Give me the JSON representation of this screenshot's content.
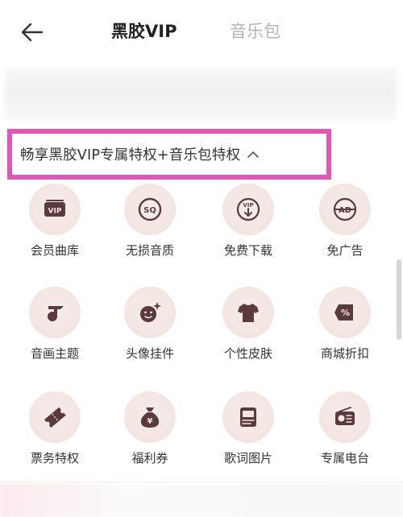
{
  "header": {
    "tabs": [
      {
        "label": "黑胶VIP",
        "active": true
      },
      {
        "label": "音乐包",
        "active": false
      }
    ]
  },
  "privileges": {
    "title": "畅享黑胶VIP专属特权+音乐包特权",
    "highlight_color": "#e256b4",
    "items": [
      {
        "label": "会员曲库",
        "icon": "vip-badge-icon"
      },
      {
        "label": "无损音质",
        "icon": "sq-quality-icon"
      },
      {
        "label": "免费下载",
        "icon": "vip-download-icon"
      },
      {
        "label": "免广告",
        "icon": "no-ad-icon"
      },
      {
        "label": "音画主题",
        "icon": "theme-icon"
      },
      {
        "label": "头像挂件",
        "icon": "avatar-pendant-icon"
      },
      {
        "label": "个性皮肤",
        "icon": "tshirt-skin-icon"
      },
      {
        "label": "商城折扣",
        "icon": "discount-tag-icon"
      },
      {
        "label": "票务特权",
        "icon": "ticket-icon"
      },
      {
        "label": "福利券",
        "icon": "money-bag-icon"
      },
      {
        "label": "歌词图片",
        "icon": "lyrics-image-icon"
      },
      {
        "label": "专属电台",
        "icon": "radio-icon"
      }
    ],
    "icon_color": "#5a3a3a",
    "icon_bg": "#f3e6e3"
  }
}
